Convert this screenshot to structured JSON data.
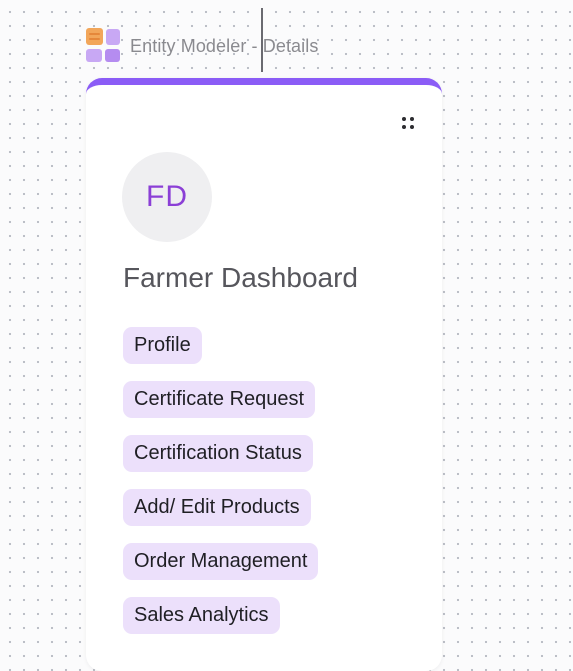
{
  "frame": {
    "title": "Entity Modeler - Details",
    "icon": "entity-modeler-grid-icon"
  },
  "card": {
    "accent_color": "#8b5cf6",
    "avatar_initials": "FD",
    "avatar_color": "#8b3fd6",
    "title": "Farmer Dashboard",
    "tag_color": "#ece0fb",
    "tags": [
      "Profile",
      "Certificate Request",
      "Certification Status",
      "Add/ Edit Products",
      "Order Management",
      "Sales Analytics"
    ]
  }
}
